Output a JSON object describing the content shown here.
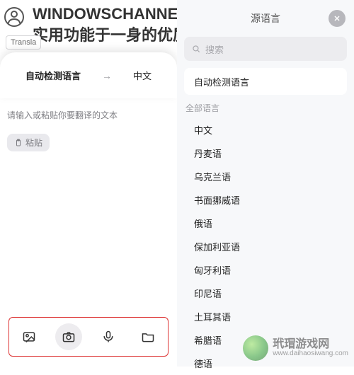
{
  "title": "WINDOWSCHANNEL 国产 APP，集多种实用功能于一身的优质应用",
  "left": {
    "badge": "Transla",
    "src_lang": "自动检测语言",
    "dst_lang": "中文",
    "placeholder": "请输入或粘贴你要翻译的文本",
    "paste": "粘贴"
  },
  "right": {
    "header": "源语言",
    "search_placeholder": "搜索",
    "selected": "自动检测语言",
    "section_label": "全部语言",
    "languages": [
      "中文",
      "丹麦语",
      "乌克兰语",
      "书面挪威语",
      "俄语",
      "保加利亚语",
      "匈牙利语",
      "印尼语",
      "土耳其语",
      "希腊语",
      "德语"
    ]
  },
  "watermark": {
    "title": "玳瑁游戏网",
    "url": "www.daihaosiwang.com"
  }
}
